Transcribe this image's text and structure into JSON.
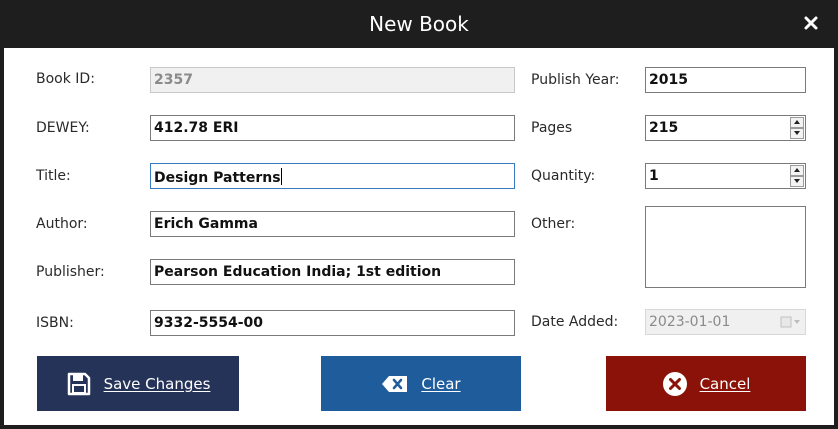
{
  "window": {
    "title": "New Book"
  },
  "labels": {
    "book_id": "Book ID:",
    "dewey": "DEWEY:",
    "title": "Title:",
    "author": "Author:",
    "publisher": "Publisher:",
    "isbn": "ISBN:",
    "publish_year": "Publish Year:",
    "pages": "Pages",
    "quantity": "Quantity:",
    "other": "Other:",
    "date_added": "Date Added:"
  },
  "values": {
    "book_id": "2357",
    "dewey": "412.78 ERI",
    "title": "Design Patterns",
    "author": "Erich Gamma",
    "publisher": "Pearson Education India; 1st edition",
    "isbn": "9332-5554-00",
    "publish_year": "2015",
    "pages": "215",
    "quantity": "1",
    "other": "",
    "date_added": "2023-01-01"
  },
  "buttons": {
    "save": "Save Changes",
    "clear": "Clear",
    "cancel": "Cancel"
  },
  "colors": {
    "titlebar": "#1e1e1e",
    "save": "#253358",
    "clear": "#1f5c9c",
    "cancel": "#8b1208"
  },
  "icons": {
    "close": "close-icon",
    "save": "floppy-disk-icon",
    "clear": "backspace-icon",
    "cancel": "circle-x-icon",
    "date": "calendar-icon"
  }
}
